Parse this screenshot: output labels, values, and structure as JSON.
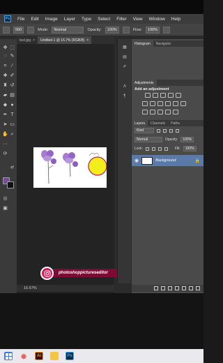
{
  "app": {
    "logo_text": "Ps"
  },
  "menu": {
    "items": [
      "File",
      "Edit",
      "Image",
      "Layer",
      "Type",
      "Select",
      "Filter",
      "View",
      "Window",
      "Help"
    ]
  },
  "options_bar": {
    "brush_size": "500",
    "mode_label": "Mode:",
    "mode_value": "Normal",
    "opacity_label": "Opacity:",
    "opacity_value": "100%",
    "flow_label": "Flow:",
    "flow_value": "100%"
  },
  "document_tabs": [
    {
      "label": "test.jpg",
      "active": false
    },
    {
      "label": "Untitled-1 @ 16.7% (RGB/8)",
      "active": true
    }
  ],
  "status": {
    "zoom": "16.67%"
  },
  "panels": {
    "histogram_tab": "Histogram",
    "navigator_tab": "Navigator",
    "adjustments_tab": "Adjustments",
    "add_adjustment": "Add an adjustment",
    "layers_tab": "Layers",
    "channels_tab": "Channels",
    "paths_tab": "Paths",
    "kind_value": "Kind",
    "blend_value": "Normal",
    "opacity_label": "Opacity:",
    "opacity_value": "100%",
    "lock_label": "Lock:",
    "fill_label": "Fill:",
    "fill_value": "100%",
    "layer_name": "Background"
  },
  "watermark": {
    "text": "photoshoppictureseditor"
  },
  "colors": {
    "foreground": "#7a4a9a",
    "background": "#111111",
    "accent": "#cc1d5a"
  }
}
